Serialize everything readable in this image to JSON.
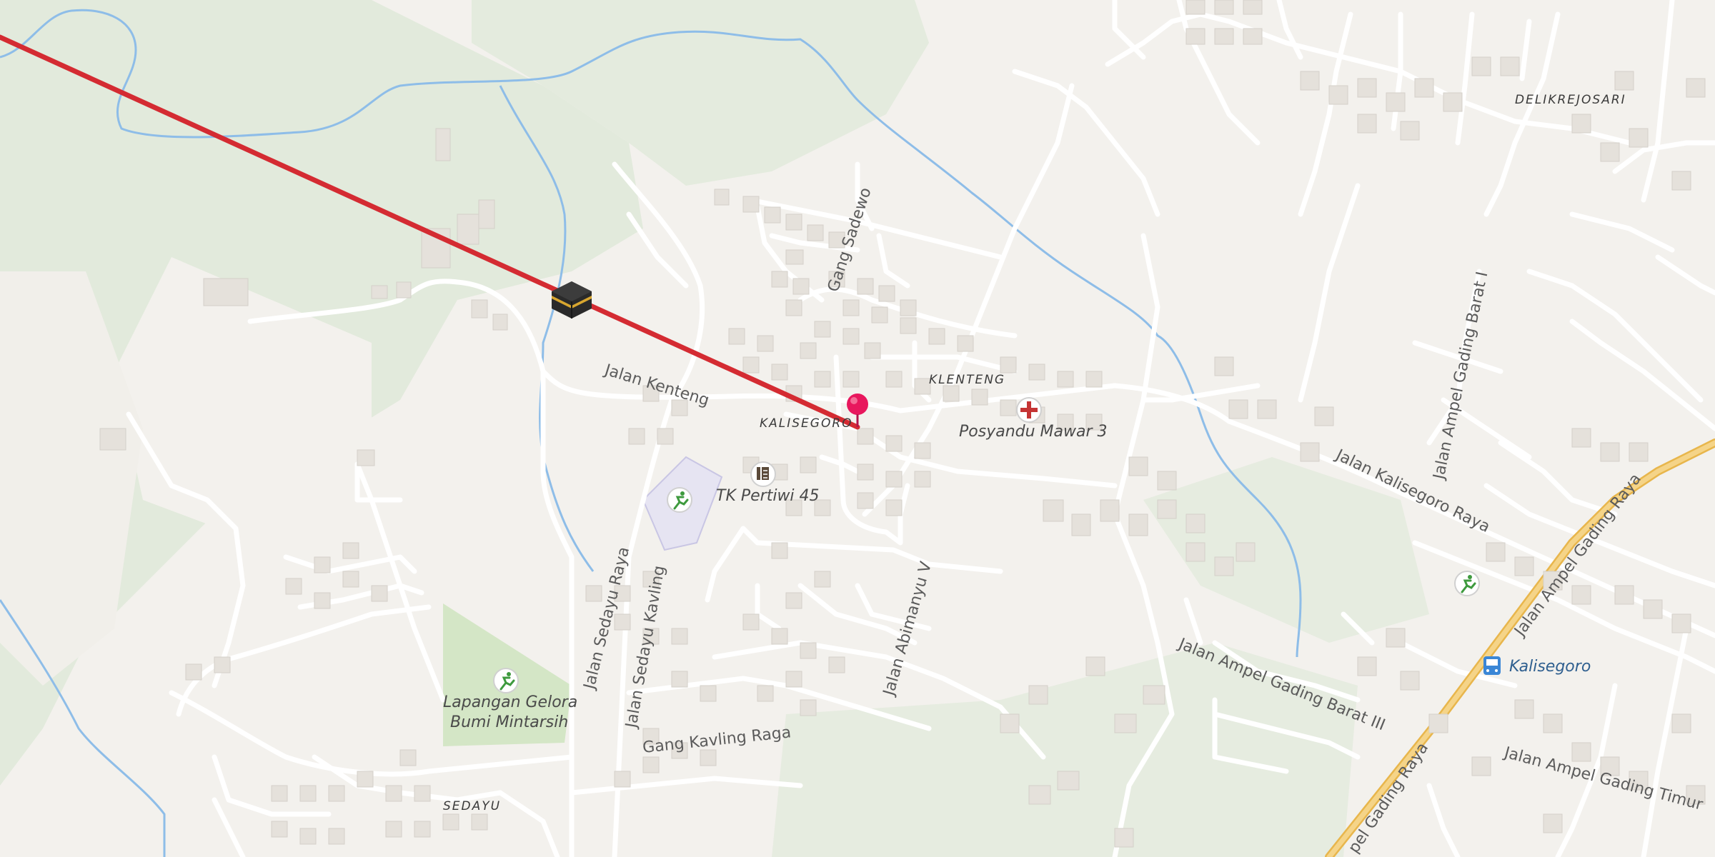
{
  "map": {
    "areas": {
      "delikrejosari": "DELIKREJOSARI",
      "klenteng": "KLENTENG",
      "kalisegoro": "KALISEGORO",
      "sedayu": "SEDAYU"
    },
    "streets": {
      "jalan_kenteng": "Jalan Kenteng",
      "gang_sadewo": "Gang Sadewo",
      "jalan_kalisegoro_raya": "Jalan Kalisegoro Raya",
      "jalan_ampel_gading_barat_i": "Jalan Ampel Gading Barat I",
      "jalan_ampel_gading_raya_1": "Jalan Ampel Gading Raya",
      "jalan_ampel_gading_raya_2": "pel Gading Raya",
      "jalan_sedayu_raya": "Jalan Sedayu Raya",
      "jalan_sedayu_kavling": "Jalan Sedayu Kavling",
      "jalan_abimanyu_v": "Jalan Abimanyu V",
      "gang_kavling_raga": "Gang Kavling Raga",
      "jalan_ampel_gading_barat_iii": "Jalan Ampel Gading Barat III",
      "jalan_ampel_gading_timur": "Jalan Ampel Gading Timur"
    },
    "pois": {
      "posyandu": "Posyandu Mawar 3",
      "tk_pertiwi": "TK Pertiwi 45",
      "lapangan_line1": "Lapangan Gelora",
      "lapangan_line2": "Bumi Mintarsih",
      "bus_stop": "Kalisegoro"
    },
    "colors": {
      "qibla_line": "#d42b32",
      "pin": "#e8175d",
      "water": "#8ebde8",
      "green": "#e2eadc",
      "major_road": "#f2c56b",
      "bus_stop": "#3a86d6"
    },
    "icons": [
      "kaaba-icon",
      "pin-icon",
      "medical-cross-icon",
      "school-icon",
      "sports-icon",
      "bus-icon"
    ]
  }
}
